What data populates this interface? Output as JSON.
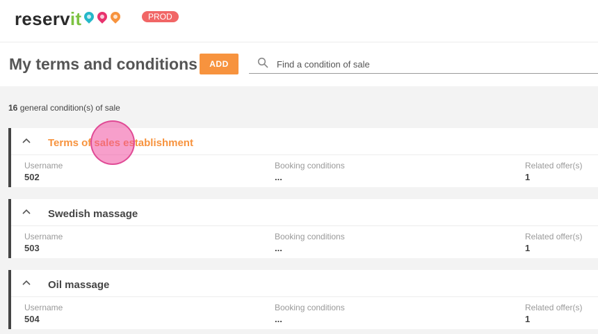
{
  "brand": {
    "name_main": "reserv",
    "name_accent": "it",
    "env_badge": "PROD",
    "pin_colors": [
      "#25b8c9",
      "#e8336e",
      "#f7933e"
    ],
    "accent_color": "#f7933e"
  },
  "header": {
    "title": "My terms and conditions",
    "add_label": "ADD",
    "search_placeholder": "Find a condition of sale",
    "search_value": ""
  },
  "summary": {
    "count": "16",
    "count_label": "general condition(s) of sale"
  },
  "columns": {
    "username": "Username",
    "booking": "Booking conditions",
    "offers": "Related offer(s)"
  },
  "conditions": [
    {
      "title": "Terms of sales establishment",
      "username": "502",
      "booking": "...",
      "offers": "1",
      "active": true
    },
    {
      "title": "Swedish massage",
      "username": "503",
      "booking": "...",
      "offers": "1",
      "active": false
    },
    {
      "title": "Oil massage",
      "username": "504",
      "booking": "...",
      "offers": "1",
      "active": false
    }
  ]
}
